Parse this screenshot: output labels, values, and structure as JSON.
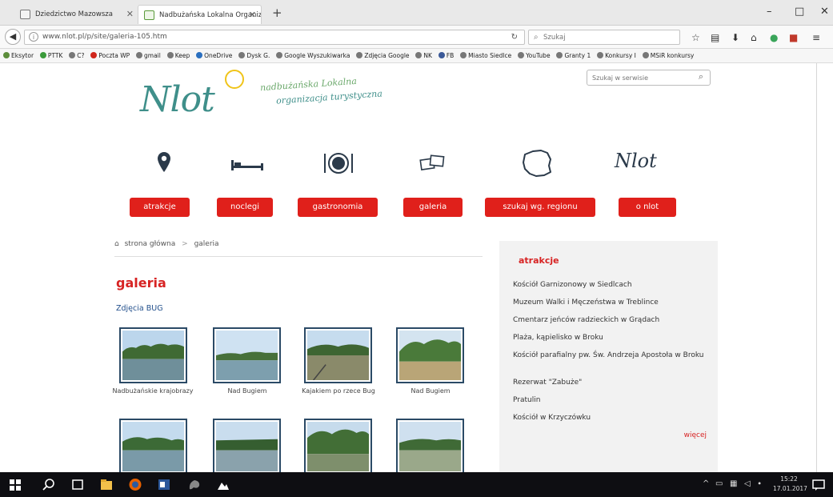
{
  "browser": {
    "tabs": [
      {
        "label": "Dziedzictwo Mazowsza",
        "active": false
      },
      {
        "label": "Nadbużańska Lokalna Organiza...",
        "active": true
      }
    ],
    "new_tab_label": "+",
    "window_controls": {
      "minimize": "–",
      "maximize": "□",
      "close": "✕"
    },
    "url": "www.nlot.pl/p/site/galeria-105.htm",
    "search_placeholder": "Szukaj",
    "bookmarks": [
      "Eksytor",
      "PTTK",
      "C?",
      "Poczta WP",
      "gmail",
      "Keep",
      "OneDrive",
      "Dysk G.",
      "Google Wyszukiwarka",
      "Zdjęcia Google",
      "NK",
      "FB",
      "Miasto Siedlce",
      "YouTube",
      "Granty 1",
      "Konkursy I",
      "MSiR konkursy"
    ]
  },
  "site": {
    "logo_text": "Nlot",
    "tagline_line1": "nadbużańska Lokalna",
    "tagline_line2": "organizacja turystyczna",
    "search_placeholder": "Szukaj w serwisie",
    "nav": [
      {
        "label": "atrakcje",
        "icon": "pin-icon"
      },
      {
        "label": "noclegi",
        "icon": "bed-icon"
      },
      {
        "label": "gastronomia",
        "icon": "plate-icon"
      },
      {
        "label": "galeria",
        "icon": "photos-icon"
      },
      {
        "label": "szukaj wg. regionu",
        "icon": "map-icon"
      },
      {
        "label": "o nlot",
        "icon": "nlot-logo-icon"
      }
    ],
    "nav_logo_small": "Nlot",
    "breadcrumb": {
      "home": "strona główna",
      "separator": ">",
      "current": "galeria"
    },
    "gallery": {
      "title": "galeria",
      "subtitle": "Zdjęcia BUG",
      "items": [
        {
          "caption": "Nadbużańskie krajobrazy"
        },
        {
          "caption": "Nad Bugiem"
        },
        {
          "caption": "Kajakiem po rzece Bug"
        },
        {
          "caption": "Nad Bugiem"
        },
        {
          "caption": ""
        },
        {
          "caption": ""
        },
        {
          "caption": ""
        },
        {
          "caption": ""
        }
      ]
    },
    "sidebar": {
      "title": "atrakcje",
      "items": [
        "Kościół Garnizonowy w Siedlcach",
        "Muzeum Walki i Męczeństwa w Treblince",
        "Cmentarz jeńców radzieckich w Grądach",
        "Plaża, kąpielisko w Broku",
        "Kościół parafialny pw. Św. Andrzeja Apostoła w Broku",
        "Rezerwat \"Zabuże\"",
        "Pratulin",
        "Kościół w Krzyczówku"
      ],
      "more": "więcej"
    }
  },
  "taskbar": {
    "clock_time": "15:22",
    "clock_date": "17.01.2017"
  },
  "colors": {
    "accent_red": "#e0201b",
    "title_red": "#d72323",
    "link_blue": "#23508c",
    "logo_teal": "#3f8f8a",
    "sun_yellow": "#f0c419"
  }
}
